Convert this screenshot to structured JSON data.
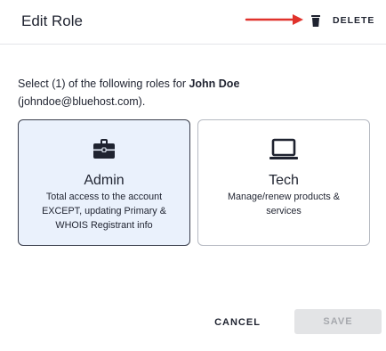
{
  "header": {
    "title": "Edit Role",
    "delete_label": "DELETE"
  },
  "prompt": {
    "prefix": "Select (1) of the following roles for ",
    "name": "John Doe",
    "email": "(johndoe@bluehost.com)."
  },
  "roles": [
    {
      "icon": "briefcase-icon",
      "title": "Admin",
      "description": "Total access to the account EXCEPT, updating Primary & WHOIS Registrant info",
      "selected": true
    },
    {
      "icon": "laptop-icon",
      "title": "Tech",
      "description": "Manage/renew products & services",
      "selected": false
    }
  ],
  "footer": {
    "cancel_label": "CANCEL",
    "save_label": "SAVE",
    "save_disabled": true
  },
  "colors": {
    "arrow": "#e0322c",
    "selected_card_bg": "#eaf1fc",
    "text": "#1f2330",
    "save_disabled_bg": "#e3e4e6"
  }
}
